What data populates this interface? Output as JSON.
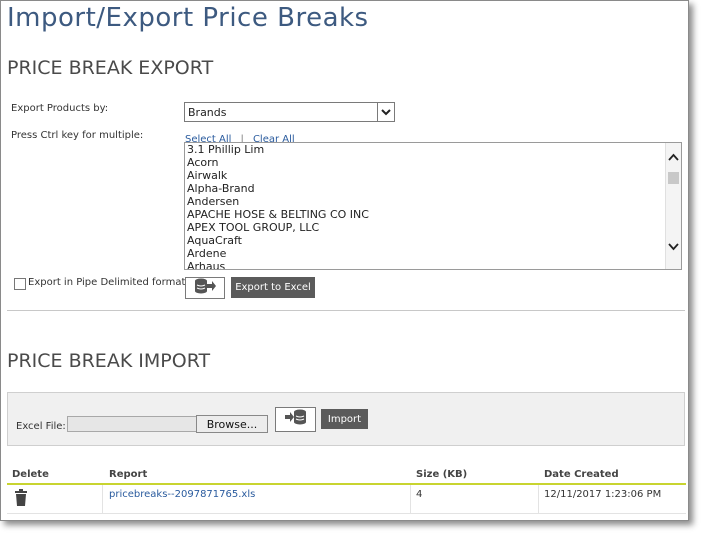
{
  "page": {
    "title": "Import/Export Price Breaks"
  },
  "export": {
    "section_title": "PRICE BREAK EXPORT",
    "export_by_label": "Export Products by:",
    "export_by_value": "Brands",
    "multi_hint": "Press Ctrl key for multiple:",
    "select_all": "Select All",
    "separator": "|",
    "clear_all": "Clear All",
    "brands": [
      "3.1 Phillip Lim",
      "Acorn",
      "Airwalk",
      "Alpha-Brand",
      "Andersen",
      "APACHE HOSE & BELTING CO INC",
      "APEX TOOL GROUP, LLC",
      "AquaCraft",
      "Ardene",
      "Arhaus"
    ],
    "pipe_label": "Export in Pipe Delimited format",
    "pipe_checked": false,
    "export_button": "Export to Excel"
  },
  "import": {
    "section_title": "PRICE BREAK IMPORT",
    "file_label": "Excel File:",
    "file_value": "",
    "browse_button": "Browse...",
    "import_button": "Import"
  },
  "table": {
    "headers": {
      "delete": "Delete",
      "report": "Report",
      "size": "Size (KB)",
      "date": "Date Created"
    },
    "rows": [
      {
        "report": "pricebreaks--2097871765.xls",
        "size": "4",
        "date": "12/11/2017 1:23:06 PM"
      }
    ]
  },
  "colors": {
    "title": "#3d5a80",
    "link": "#2a5b9e",
    "button": "#5b5b5b",
    "header_rule": "#c8d430"
  }
}
